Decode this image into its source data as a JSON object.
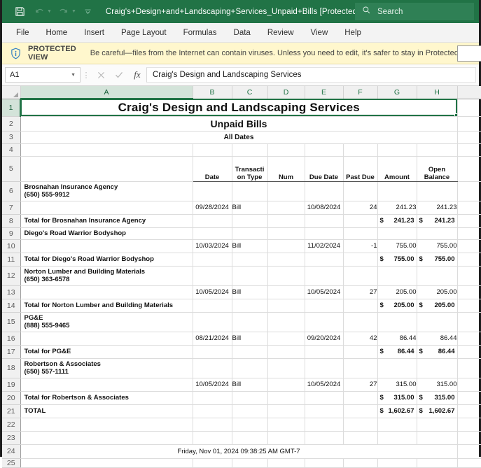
{
  "titlebar": {
    "filename": "Craig's+Design+and+Landscaping+Services_Unpaid+Bills  [Protected View]  -  Ex...",
    "save_icon": "save-icon",
    "undo_icon": "undo-icon",
    "redo_icon": "redo-icon",
    "qat_more_icon": "chevron-down-icon",
    "brand_color": "#217346"
  },
  "search": {
    "placeholder": "Search",
    "icon": "search-icon"
  },
  "ribbon": {
    "tabs": [
      {
        "label": "File"
      },
      {
        "label": "Home"
      },
      {
        "label": "Insert"
      },
      {
        "label": "Page Layout"
      },
      {
        "label": "Formulas"
      },
      {
        "label": "Data"
      },
      {
        "label": "Review"
      },
      {
        "label": "View"
      },
      {
        "label": "Help"
      }
    ]
  },
  "protected_view": {
    "icon": "info-shield-icon",
    "label": "PROTECTED VIEW",
    "message": "Be careful—files from the Internet can contain viruses. Unless you need to edit, it's safer to stay in Protected View.",
    "button_label": "",
    "bg_color": "#fff7cd"
  },
  "formula_bar": {
    "name_box_value": "A1",
    "name_box_caret": "chevron-down-icon",
    "cancel_icon": "cancel-x-icon",
    "confirm_icon": "confirm-check-icon",
    "function_icon": "fx-icon",
    "formula_value": "Craig's Design and Landscaping Services"
  },
  "grid": {
    "columns": [
      "A",
      "B",
      "C",
      "D",
      "E",
      "F",
      "G",
      "H"
    ],
    "selected_cell": "A1",
    "titles": {
      "line1": "Craig's Design and Landscaping Services",
      "line2": "Unpaid Bills",
      "line3": "All Dates"
    },
    "headers": {
      "date": "Date",
      "transaction_type_1": "Transacti",
      "transaction_type_2": "on Type",
      "num": "Num",
      "due_date": "Due Date",
      "past_due": "Past Due",
      "amount": "Amount",
      "open_balance_1": "Open",
      "open_balance_2": "Balance"
    },
    "rows": [
      {
        "n": "1",
        "type": "title1"
      },
      {
        "n": "2",
        "type": "title2"
      },
      {
        "n": "3",
        "type": "title3"
      },
      {
        "n": "4",
        "type": "blank"
      },
      {
        "n": "5",
        "type": "header"
      },
      {
        "n": "6",
        "type": "vendor",
        "vendor": "Brosnahan Insurance Agency",
        "phone": "(650) 555-9912"
      },
      {
        "n": "7",
        "type": "data",
        "date": "09/28/2024",
        "txn": "Bill",
        "num": "",
        "due": "10/08/2024",
        "past_due": "24",
        "amount": "241.23",
        "open": "241.23"
      },
      {
        "n": "8",
        "type": "total",
        "label": "Total for Brosnahan Insurance Agency",
        "sym": "$",
        "amount": "241.23",
        "open": "241.23"
      },
      {
        "n": "9",
        "type": "vendor1",
        "vendor": "Diego's Road Warrior Bodyshop"
      },
      {
        "n": "10",
        "type": "data",
        "date": "10/03/2024",
        "txn": "Bill",
        "num": "",
        "due": "11/02/2024",
        "past_due": "-1",
        "amount": "755.00",
        "open": "755.00"
      },
      {
        "n": "11",
        "type": "total",
        "label": "Total for Diego's Road Warrior Bodyshop",
        "sym": "$",
        "amount": "755.00",
        "open": "755.00"
      },
      {
        "n": "12",
        "type": "vendor",
        "vendor": "Norton Lumber and Building Materials",
        "phone": "(650) 363-6578"
      },
      {
        "n": "13",
        "type": "data",
        "date": "10/05/2024",
        "txn": "Bill",
        "num": "",
        "due": "10/05/2024",
        "past_due": "27",
        "amount": "205.00",
        "open": "205.00"
      },
      {
        "n": "14",
        "type": "total",
        "label": "Total for Norton Lumber and Building Materials",
        "sym": "$",
        "amount": "205.00",
        "open": "205.00"
      },
      {
        "n": "15",
        "type": "vendor",
        "vendor": "PG&E",
        "phone": "(888) 555-9465"
      },
      {
        "n": "16",
        "type": "data",
        "date": "08/21/2024",
        "txn": "Bill",
        "num": "",
        "due": "09/20/2024",
        "past_due": "42",
        "amount": "86.44",
        "open": "86.44"
      },
      {
        "n": "17",
        "type": "total",
        "label": "Total for PG&E",
        "sym": "$",
        "amount": "86.44",
        "open": "86.44"
      },
      {
        "n": "18",
        "type": "vendor",
        "vendor": "Robertson & Associates",
        "phone": "(650) 557-1111"
      },
      {
        "n": "19",
        "type": "data",
        "date": "10/05/2024",
        "txn": "Bill",
        "num": "",
        "due": "10/05/2024",
        "past_due": "27",
        "amount": "315.00",
        "open": "315.00"
      },
      {
        "n": "20",
        "type": "total",
        "label": "Total for Robertson & Associates",
        "sym": "$",
        "amount": "315.00",
        "open": "315.00"
      },
      {
        "n": "21",
        "type": "grandtotal",
        "label": "TOTAL",
        "sym": "$",
        "amount": "1,602.67",
        "open": "1,602.67"
      },
      {
        "n": "22",
        "type": "blank"
      },
      {
        "n": "23",
        "type": "blank"
      },
      {
        "n": "24",
        "type": "footer",
        "timestamp": "Friday, Nov 01, 2024 09:38:25 AM GMT-7"
      },
      {
        "n": "25",
        "type": "blank"
      }
    ]
  }
}
